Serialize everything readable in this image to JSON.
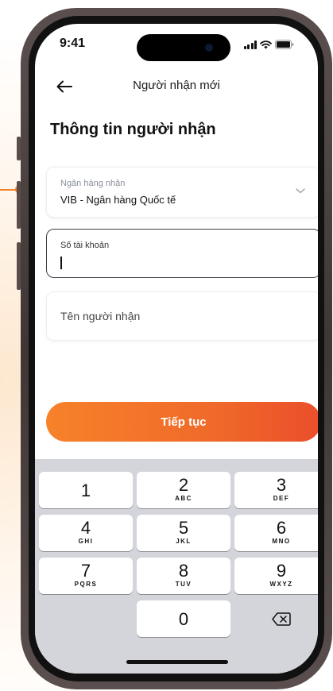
{
  "status_bar": {
    "time": "9:41"
  },
  "nav": {
    "title": "Người nhận mới"
  },
  "section_title": "Thông tin người nhận",
  "bank_field": {
    "label": "Ngân hàng nhận",
    "value": "VIB - Ngân hàng Quốc tế"
  },
  "account_field": {
    "label": "Số tài khoản",
    "value": ""
  },
  "name_field": {
    "placeholder": "Tên người nhận"
  },
  "continue_button": {
    "label": "Tiếp tục"
  },
  "keypad": {
    "keys": [
      {
        "digit": "1",
        "letters": ""
      },
      {
        "digit": "2",
        "letters": "ABC"
      },
      {
        "digit": "3",
        "letters": "DEF"
      },
      {
        "digit": "4",
        "letters": "GHI"
      },
      {
        "digit": "5",
        "letters": "JKL"
      },
      {
        "digit": "6",
        "letters": "MNO"
      },
      {
        "digit": "7",
        "letters": "PQRS"
      },
      {
        "digit": "8",
        "letters": "TUV"
      },
      {
        "digit": "9",
        "letters": "WXYZ"
      },
      {
        "digit": "0",
        "letters": ""
      }
    ],
    "delete_icon": "backspace-icon"
  },
  "colors": {
    "accent_start": "#f7822a",
    "accent_end": "#ea4f2b",
    "connector": "#f0812b"
  }
}
